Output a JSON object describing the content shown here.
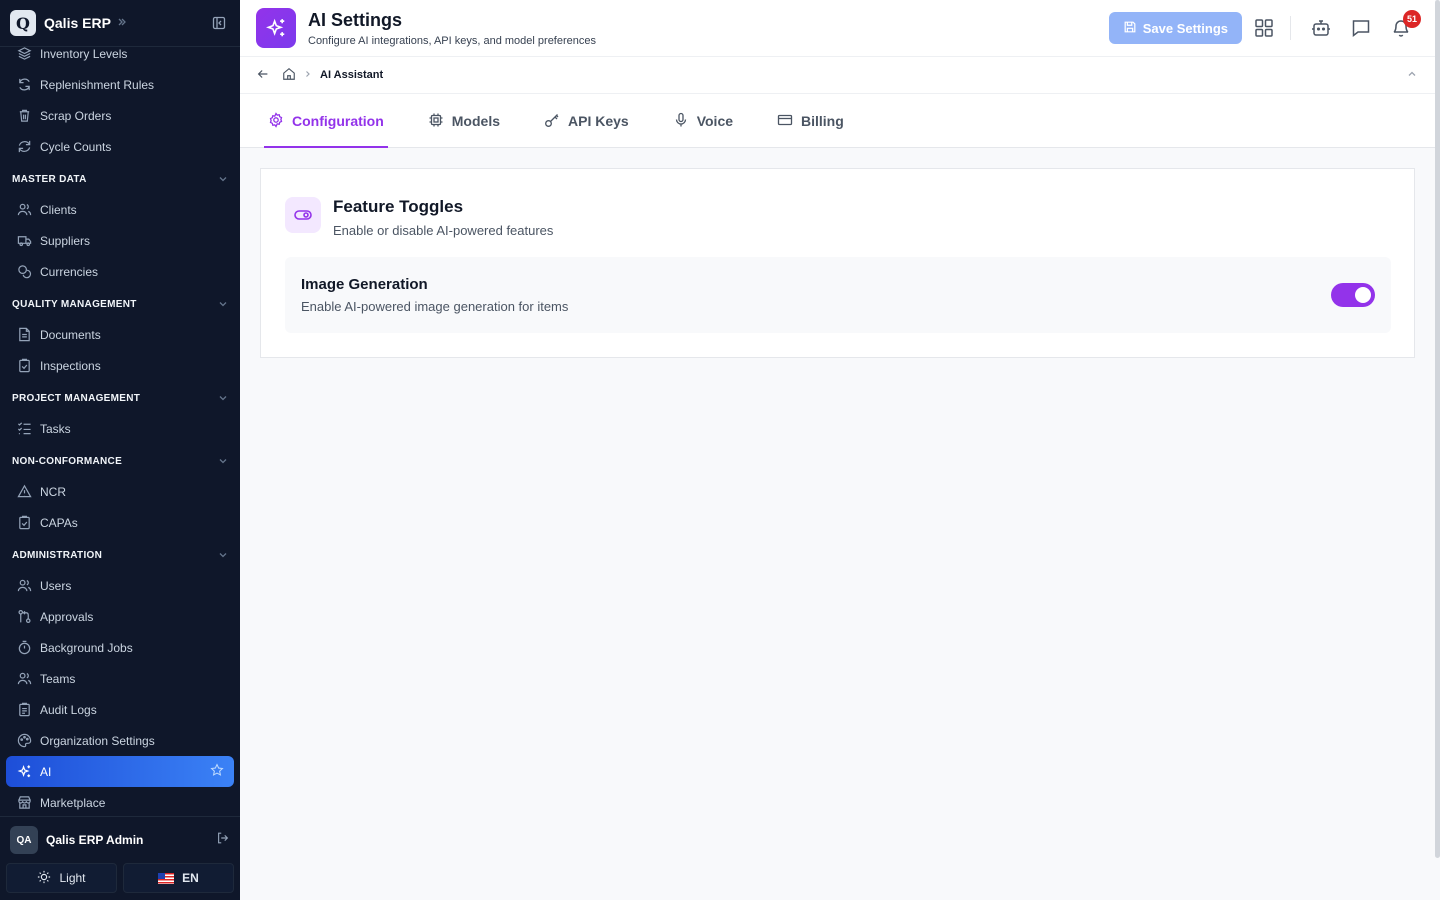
{
  "app": {
    "logo_letter": "Q",
    "name": "Qalis ERP"
  },
  "sidebar": {
    "top_items": [
      {
        "label": "Inventory Levels",
        "icon": "layers-icon"
      },
      {
        "label": "Replenishment Rules",
        "icon": "refresh-icon"
      },
      {
        "label": "Scrap Orders",
        "icon": "trash-icon"
      },
      {
        "label": "Cycle Counts",
        "icon": "cycle-icon"
      }
    ],
    "sections": [
      {
        "title": "MASTER DATA",
        "items": [
          {
            "label": "Clients",
            "icon": "users-icon"
          },
          {
            "label": "Suppliers",
            "icon": "truck-icon"
          },
          {
            "label": "Currencies",
            "icon": "coins-icon"
          }
        ]
      },
      {
        "title": "QUALITY MANAGEMENT",
        "items": [
          {
            "label": "Documents",
            "icon": "document-icon"
          },
          {
            "label": "Inspections",
            "icon": "clipboard-check-icon"
          }
        ]
      },
      {
        "title": "PROJECT MANAGEMENT",
        "items": [
          {
            "label": "Tasks",
            "icon": "list-checks-icon"
          }
        ]
      },
      {
        "title": "NON-CONFORMANCE",
        "items": [
          {
            "label": "NCR",
            "icon": "warning-icon"
          },
          {
            "label": "CAPAs",
            "icon": "clipboard-check-icon"
          }
        ]
      },
      {
        "title": "ADMINISTRATION",
        "items": [
          {
            "label": "Users",
            "icon": "users-icon"
          },
          {
            "label": "Approvals",
            "icon": "git-pull-icon"
          },
          {
            "label": "Background Jobs",
            "icon": "timer-icon"
          },
          {
            "label": "Teams",
            "icon": "users-icon"
          },
          {
            "label": "Audit Logs",
            "icon": "clipboard-icon"
          },
          {
            "label": "Organization Settings",
            "icon": "palette-icon"
          },
          {
            "label": "AI",
            "icon": "sparkles-icon",
            "active": true
          },
          {
            "label": "Marketplace",
            "icon": "store-icon"
          }
        ]
      }
    ],
    "user": {
      "initials": "QA",
      "name": "Qalis ERP Admin"
    },
    "theme_label": "Light",
    "language_label": "EN"
  },
  "header": {
    "title": "AI Settings",
    "subtitle": "Configure AI integrations, API keys, and model preferences",
    "save_label": "Save Settings",
    "notification_count": "51"
  },
  "breadcrumb": {
    "current": "AI Assistant"
  },
  "tabs": [
    {
      "label": "Configuration",
      "icon": "gear-icon",
      "active": true
    },
    {
      "label": "Models",
      "icon": "cpu-icon"
    },
    {
      "label": "API Keys",
      "icon": "key-icon"
    },
    {
      "label": "Voice",
      "icon": "microphone-icon"
    },
    {
      "label": "Billing",
      "icon": "credit-card-icon"
    }
  ],
  "card": {
    "title": "Feature Toggles",
    "subtitle": "Enable or disable AI-powered features",
    "toggles": [
      {
        "title": "Image Generation",
        "description": "Enable AI-powered image generation for items",
        "enabled": true
      }
    ]
  },
  "colors": {
    "accent": "#9333ea",
    "sidebar_bg": "#0f172a",
    "active_nav": "#2563eb",
    "save_button": "#93b4f8",
    "badge": "#dc2626"
  }
}
